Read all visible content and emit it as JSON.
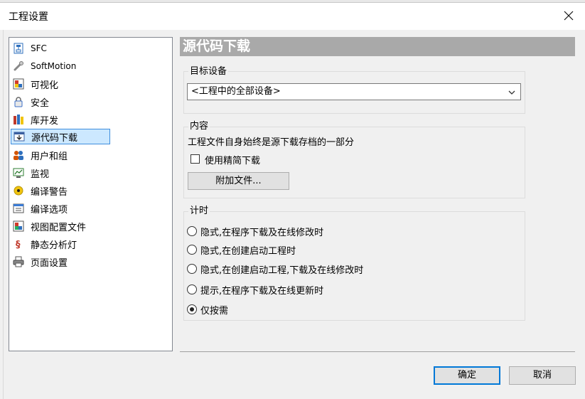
{
  "window": {
    "title": "工程设置"
  },
  "sidebar": {
    "items": [
      {
        "label": "SFC",
        "icon": "sfc-icon",
        "color": "#2e6fbd"
      },
      {
        "label": "SoftMotion",
        "icon": "softmotion-icon",
        "color": "#7a7a7a"
      },
      {
        "label": "可视化",
        "icon": "visualization-icon",
        "color": "#d03a2b"
      },
      {
        "label": "安全",
        "icon": "lock-icon",
        "color": "#3b6fc8"
      },
      {
        "label": "库开发",
        "icon": "library-icon",
        "color": "#c0392b"
      },
      {
        "label": "源代码下载",
        "icon": "source-download-icon",
        "color": "#3a5fa0",
        "selected": true
      },
      {
        "label": "用户和组",
        "icon": "users-icon",
        "color": "#d35400"
      },
      {
        "label": "监视",
        "icon": "monitor-icon",
        "color": "#2e7d32"
      },
      {
        "label": "编译警告",
        "icon": "warning-icon",
        "color": "#f1c40f"
      },
      {
        "label": "编译选项",
        "icon": "compile-options-icon",
        "color": "#3a7bd5"
      },
      {
        "label": "视图配置文件",
        "icon": "view-profile-icon",
        "color": "#d03a2b"
      },
      {
        "label": "静态分析灯",
        "icon": "static-analysis-icon",
        "color": "#c0392b"
      },
      {
        "label": "页面设置",
        "icon": "printer-icon",
        "color": "#555555"
      }
    ]
  },
  "panel": {
    "title": "源代码下载",
    "target": {
      "label": "目标设备",
      "selected": "<工程中的全部设备>"
    },
    "content": {
      "label": "内容",
      "description": "工程文件自身始终是源下载存档的一部分",
      "compact_checkbox": "使用精简下载",
      "compact_checked": false,
      "attach_button": "附加文件..."
    },
    "timing": {
      "label": "计时",
      "options": [
        "隐式,在程序下载及在线修改时",
        "隐式,在创建启动工程时",
        "隐式,在创建启动工程,下载及在线修改时",
        "提示,在程序下载及在线更新时",
        "仅按需"
      ],
      "selected_index": 4
    }
  },
  "footer": {
    "ok": "确定",
    "cancel": "取消"
  },
  "colors": {
    "selection_bg": "#cce8ff",
    "selection_border": "#3e8ddd",
    "header_bg": "#a9a9a9",
    "default_button_border": "#0078d7"
  }
}
